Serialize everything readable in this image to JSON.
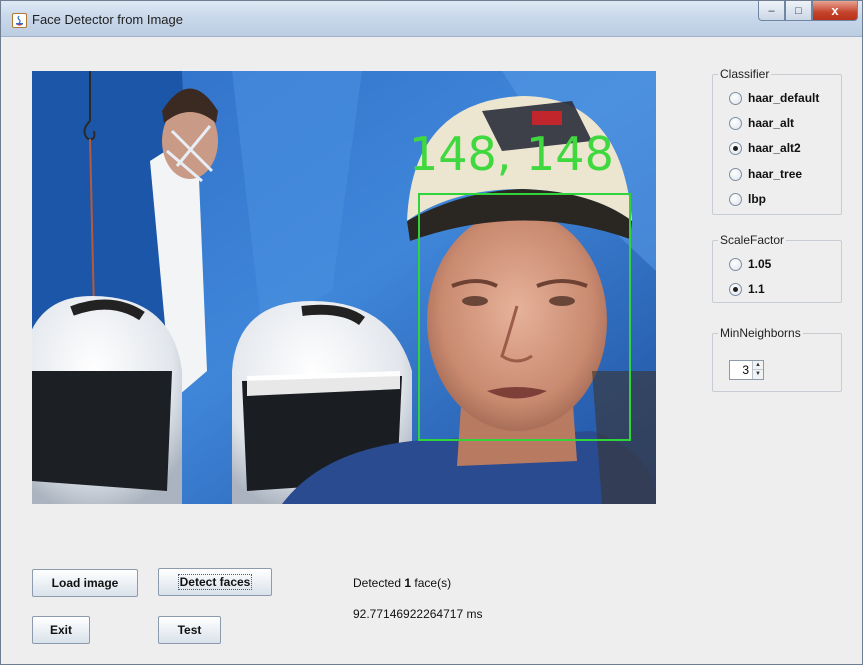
{
  "window": {
    "title": "Face Detector from Image",
    "controls": {
      "minimize": "–",
      "maximize": "□",
      "close": "x"
    }
  },
  "image": {
    "overlay_text": "148, 148",
    "box_color": "#2fd33a"
  },
  "classifier": {
    "title": "Classifier",
    "options": [
      "haar_default",
      "haar_alt",
      "haar_alt2",
      "haar_tree",
      "lbp"
    ],
    "selected": "haar_alt2"
  },
  "scale_factor": {
    "title": "ScaleFactor",
    "options": [
      "1.05",
      "1.1"
    ],
    "selected": "1.1"
  },
  "min_neighbors": {
    "title": "MinNeighborns",
    "value": "3"
  },
  "buttons": {
    "load": "Load image",
    "detect": "Detect faces",
    "exit": "Exit",
    "test": "Test"
  },
  "status": {
    "detected_prefix": "Detected ",
    "detected_count": "1",
    "detected_suffix": " face(s)",
    "time": "92.77146922264717 ms"
  }
}
